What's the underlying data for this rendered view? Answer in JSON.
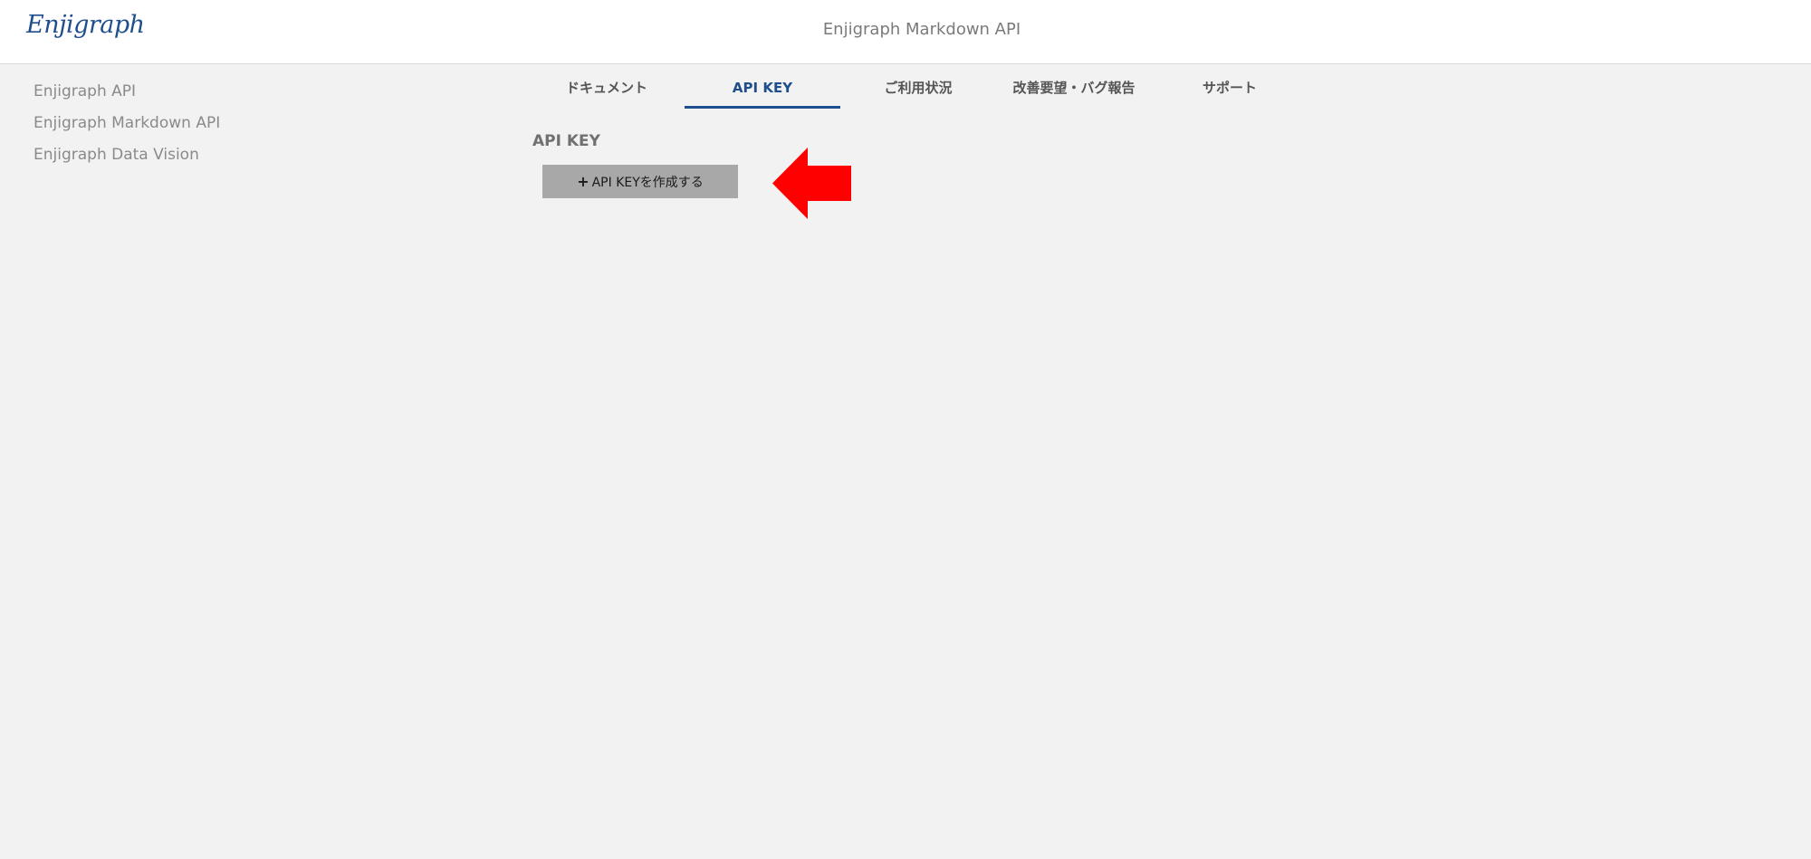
{
  "header": {
    "logo": "Enjigraph",
    "title": "Enjigraph Markdown API"
  },
  "sidebar": {
    "items": [
      {
        "label": "Enjigraph API"
      },
      {
        "label": "Enjigraph Markdown API"
      },
      {
        "label": "Enjigraph Data Vision"
      }
    ]
  },
  "tabs": [
    {
      "label": "ドキュメント",
      "active": false
    },
    {
      "label": "API KEY",
      "active": true
    },
    {
      "label": "ご利用状況",
      "active": false
    },
    {
      "label": "改善要望・バグ報告",
      "active": false
    },
    {
      "label": "サポート",
      "active": false
    }
  ],
  "main": {
    "section_title": "API KEY",
    "create_button": {
      "icon": "plus-icon",
      "label": "API KEYを作成する"
    }
  },
  "annotation": {
    "icon": "left-arrow-icon",
    "color": "#ff0000"
  },
  "colors": {
    "brand": "#1e4e8c",
    "background": "#f2f2f2",
    "button": "#a8a8a8"
  }
}
